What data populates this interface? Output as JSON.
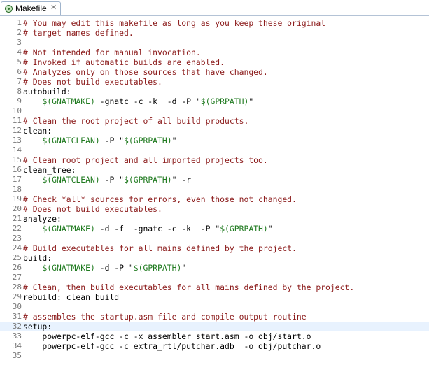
{
  "tab": {
    "label": "Makefile",
    "close_glyph": "✕",
    "icon": "makefile-file-icon"
  },
  "colors": {
    "comment": "#8b1a1a",
    "variable": "#1f7a1f",
    "text": "#000000",
    "line_number": "#787878",
    "current_line": "#e8f2fe"
  },
  "current_line": 32,
  "lines": [
    {
      "n": "1",
      "segs": [
        {
          "t": "# You may edit this makefile as long as you keep these original",
          "c": "comment"
        }
      ]
    },
    {
      "n": "2",
      "segs": [
        {
          "t": "# target names defined.",
          "c": "comment"
        }
      ]
    },
    {
      "n": "3",
      "segs": []
    },
    {
      "n": "4",
      "segs": [
        {
          "t": "# Not intended for manual invocation.",
          "c": "comment"
        }
      ]
    },
    {
      "n": "5",
      "segs": [
        {
          "t": "# Invoked if automatic builds are enabled.",
          "c": "comment"
        }
      ]
    },
    {
      "n": "6",
      "segs": [
        {
          "t": "# Analyzes only on those sources that have changed.",
          "c": "comment"
        }
      ]
    },
    {
      "n": "7",
      "segs": [
        {
          "t": "# Does not build executables.",
          "c": "comment"
        }
      ]
    },
    {
      "n": "8",
      "segs": [
        {
          "t": "autobuild:",
          "c": "target"
        }
      ]
    },
    {
      "n": "9",
      "segs": [
        {
          "t": "    ",
          "c": "cmd"
        },
        {
          "t": "$(GNATMAKE)",
          "c": "var"
        },
        {
          "t": " -gnatc -c -k  -d -P \"",
          "c": "cmd"
        },
        {
          "t": "$(GPRPATH)",
          "c": "var"
        },
        {
          "t": "\"",
          "c": "cmd"
        }
      ]
    },
    {
      "n": "10",
      "segs": []
    },
    {
      "n": "11",
      "segs": [
        {
          "t": "# Clean the root project of all build products.",
          "c": "comment"
        }
      ]
    },
    {
      "n": "12",
      "segs": [
        {
          "t": "clean:",
          "c": "target"
        }
      ]
    },
    {
      "n": "13",
      "segs": [
        {
          "t": "    ",
          "c": "cmd"
        },
        {
          "t": "$(GNATCLEAN)",
          "c": "var"
        },
        {
          "t": " -P \"",
          "c": "cmd"
        },
        {
          "t": "$(GPRPATH)",
          "c": "var"
        },
        {
          "t": "\"",
          "c": "cmd"
        }
      ]
    },
    {
      "n": "14",
      "segs": []
    },
    {
      "n": "15",
      "segs": [
        {
          "t": "# Clean root project and all imported projects too.",
          "c": "comment"
        }
      ]
    },
    {
      "n": "16",
      "segs": [
        {
          "t": "clean_tree:",
          "c": "target"
        }
      ]
    },
    {
      "n": "17",
      "segs": [
        {
          "t": "    ",
          "c": "cmd"
        },
        {
          "t": "$(GNATCLEAN)",
          "c": "var"
        },
        {
          "t": " -P \"",
          "c": "cmd"
        },
        {
          "t": "$(GPRPATH)",
          "c": "var"
        },
        {
          "t": "\" -r",
          "c": "cmd"
        }
      ]
    },
    {
      "n": "18",
      "segs": []
    },
    {
      "n": "19",
      "segs": [
        {
          "t": "# Check *all* sources for errors, even those not changed.",
          "c": "comment"
        }
      ]
    },
    {
      "n": "20",
      "segs": [
        {
          "t": "# Does not build executables.",
          "c": "comment"
        }
      ]
    },
    {
      "n": "21",
      "segs": [
        {
          "t": "analyze:",
          "c": "target"
        }
      ]
    },
    {
      "n": "22",
      "segs": [
        {
          "t": "    ",
          "c": "cmd"
        },
        {
          "t": "$(GNATMAKE)",
          "c": "var"
        },
        {
          "t": " -d -f  -gnatc -c -k  -P \"",
          "c": "cmd"
        },
        {
          "t": "$(GPRPATH)",
          "c": "var"
        },
        {
          "t": "\"",
          "c": "cmd"
        }
      ]
    },
    {
      "n": "23",
      "segs": []
    },
    {
      "n": "24",
      "segs": [
        {
          "t": "# Build executables for all mains defined by the project.",
          "c": "comment"
        }
      ]
    },
    {
      "n": "25",
      "segs": [
        {
          "t": "build:",
          "c": "target"
        }
      ]
    },
    {
      "n": "26",
      "segs": [
        {
          "t": "    ",
          "c": "cmd"
        },
        {
          "t": "$(GNATMAKE)",
          "c": "var"
        },
        {
          "t": " -d -P \"",
          "c": "cmd"
        },
        {
          "t": "$(GPRPATH)",
          "c": "var"
        },
        {
          "t": "\"",
          "c": "cmd"
        }
      ]
    },
    {
      "n": "27",
      "segs": []
    },
    {
      "n": "28",
      "segs": [
        {
          "t": "# Clean, then build executables for all mains defined by the project.",
          "c": "comment"
        }
      ]
    },
    {
      "n": "29",
      "segs": [
        {
          "t": "rebuild: clean build",
          "c": "target"
        }
      ]
    },
    {
      "n": "30",
      "segs": []
    },
    {
      "n": "31",
      "segs": [
        {
          "t": "# assembles the startup.asm file and compile output routine",
          "c": "comment"
        }
      ]
    },
    {
      "n": "32",
      "segs": [
        {
          "t": "setup:",
          "c": "target"
        }
      ]
    },
    {
      "n": "33",
      "segs": [
        {
          "t": "    powerpc-elf-gcc -c -x assembler start.asm -o obj/start.o",
          "c": "cmd"
        }
      ]
    },
    {
      "n": "34",
      "segs": [
        {
          "t": "    powerpc-elf-gcc -c extra_rtl/putchar.adb  -o obj/putchar.o",
          "c": "cmd"
        }
      ]
    },
    {
      "n": "35",
      "segs": []
    }
  ]
}
